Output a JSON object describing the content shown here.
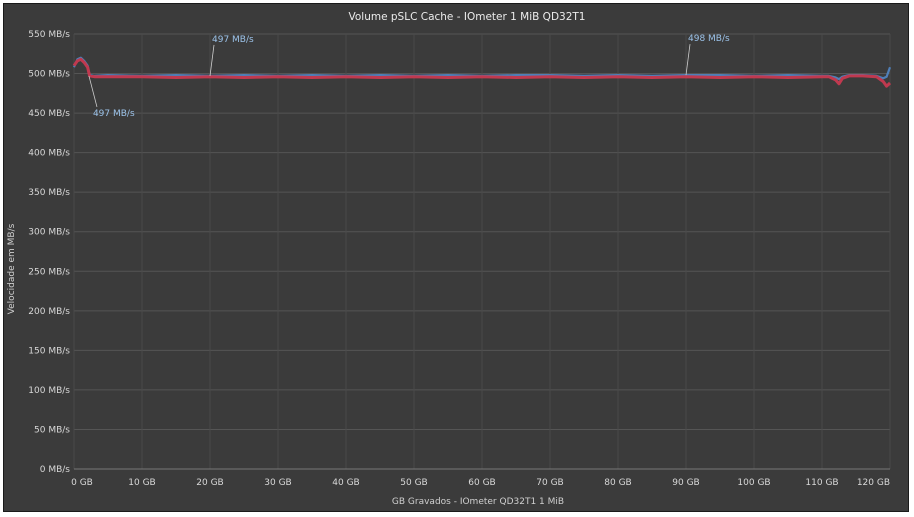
{
  "chart_data": {
    "type": "line",
    "title": "Volume pSLC Cache - IOmeter 1 MiB QD32T1",
    "xlabel": "GB Gravados - IOmeter QD32T1 1 MiB",
    "ylabel": "Velocidade em MB/s",
    "xlim": [
      0,
      120
    ],
    "ylim": [
      0,
      550
    ],
    "x_ticks": [
      0,
      10,
      20,
      30,
      40,
      50,
      60,
      70,
      80,
      90,
      100,
      110,
      120
    ],
    "x_tick_labels": [
      "0 GB",
      "10 GB",
      "20 GB",
      "30 GB",
      "40 GB",
      "50 GB",
      "60 GB",
      "70 GB",
      "80 GB",
      "90 GB",
      "100 GB",
      "110 GB",
      "120 GB"
    ],
    "y_ticks": [
      0,
      50,
      100,
      150,
      200,
      250,
      300,
      350,
      400,
      450,
      500,
      550
    ],
    "y_tick_labels": [
      "0 MB/s",
      "50 MB/s",
      "100 MB/s",
      "150 MB/s",
      "200 MB/s",
      "250 MB/s",
      "300 MB/s",
      "350 MB/s",
      "400 MB/s",
      "450 MB/s",
      "500 MB/s",
      "550 MB/s"
    ],
    "grid": true,
    "series": [
      {
        "color": "#4f7fb8",
        "x": [
          0,
          0.5,
          1,
          1.5,
          2,
          2.3,
          3,
          5,
          10,
          15,
          20,
          25,
          30,
          35,
          40,
          45,
          50,
          55,
          60,
          65,
          70,
          75,
          80,
          85,
          90,
          95,
          100,
          105,
          110,
          111,
          112,
          112.5,
          113,
          114,
          116,
          118,
          119,
          119.5,
          120
        ],
        "y": [
          508,
          518,
          520,
          516,
          510,
          498,
          497,
          498,
          497,
          498,
          497,
          498,
          497,
          498,
          497,
          498,
          497,
          498,
          497,
          498,
          498,
          497,
          498,
          497,
          498,
          498,
          497,
          498,
          497,
          497,
          495,
          493,
          496,
          498,
          498,
          497,
          494,
          496,
          508
        ]
      },
      {
        "color": "#c0394f",
        "x": [
          0,
          0.5,
          1,
          1.5,
          2,
          2.3,
          3,
          5,
          10,
          15,
          20,
          25,
          30,
          35,
          40,
          45,
          50,
          55,
          60,
          65,
          70,
          75,
          80,
          85,
          90,
          95,
          100,
          105,
          110,
          111,
          112,
          112.5,
          113,
          114,
          116,
          118,
          119,
          119.5,
          120
        ],
        "y": [
          510,
          516,
          518,
          514,
          508,
          497,
          496,
          496,
          496,
          495,
          496,
          495,
          496,
          495,
          496,
          495,
          496,
          495,
          496,
          495,
          496,
          495,
          496,
          495,
          496,
          495,
          496,
          495,
          496,
          496,
          492,
          487,
          494,
          497,
          497,
          496,
          490,
          484,
          488
        ]
      }
    ],
    "annotations": [
      {
        "text": "497 MB/s",
        "x": 2.2,
        "y": 497,
        "side": "below"
      },
      {
        "text": "497 MB/s",
        "x": 20,
        "y": 497,
        "side": "above"
      },
      {
        "text": "498 MB/s",
        "x": 90,
        "y": 498,
        "side": "above"
      }
    ]
  }
}
